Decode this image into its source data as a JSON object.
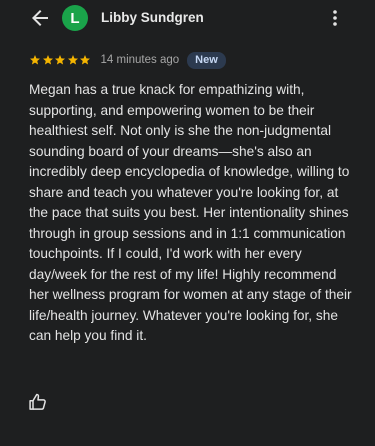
{
  "header": {
    "back_icon": "arrow-left-icon",
    "avatar_letter": "L",
    "avatar_color": "#1aa34a",
    "reviewer_name": "Libby Sundgren",
    "menu_icon": "more-vert-icon"
  },
  "review": {
    "rating": 5,
    "max_rating": 5,
    "star_color": "#f4b400",
    "timestamp": "14 minutes ago",
    "badge_label": "New",
    "badge_bg": "#2c3a4f",
    "badge_color": "#c6d8f4",
    "text": "Megan has a true knack for empathizing with, supporting, and empowering women to be their healthiest self. Not only is she the non-judgmental sounding board of your dreams—she's also an incredibly deep encyclopedia of knowledge, willing to share and teach you whatever you're looking for, at the pace that suits you best. Her intentionality shines through in group sessions and in 1:1 communication touchpoints. If I could, I'd work with her every day/week for the rest of my life! Highly recommend her wellness program for women at any stage of their life/health journey. Whatever you're looking for, she can help you find it."
  },
  "actions": {
    "like_icon": "thumb-up-icon"
  }
}
